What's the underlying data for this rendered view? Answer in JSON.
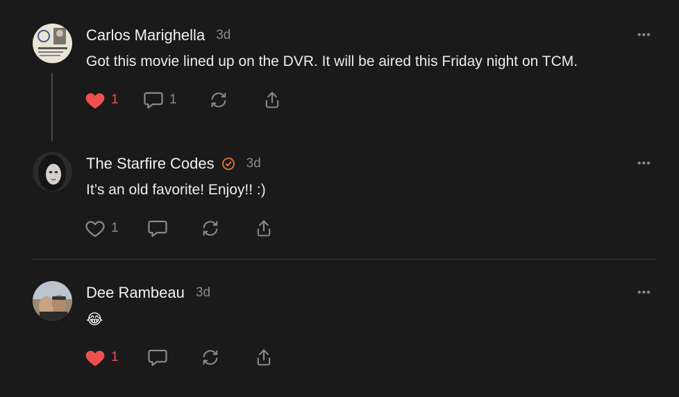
{
  "comments": [
    {
      "author": "Carlos Marighella",
      "time": "3d",
      "text": "Got this movie lined up on the DVR. It will be aired this Friday night on TCM.",
      "like_count": "1",
      "liked": true,
      "reply_count": "1",
      "more": "•••"
    },
    {
      "author": "The Starfire Codes",
      "time": "3d",
      "verified": true,
      "text": "It’s an old favorite! Enjoy!! :)",
      "like_count": "1",
      "liked": false,
      "more": "•••"
    },
    {
      "author": "Dee Rambeau",
      "time": "3d",
      "text": "😂",
      "like_count": "1",
      "liked": true,
      "more": "•••"
    }
  ],
  "colors": {
    "background": "#1a1a1b",
    "like_red": "#f0504f",
    "verified_orange": "#f0743a",
    "muted": "#8a8a8e"
  }
}
